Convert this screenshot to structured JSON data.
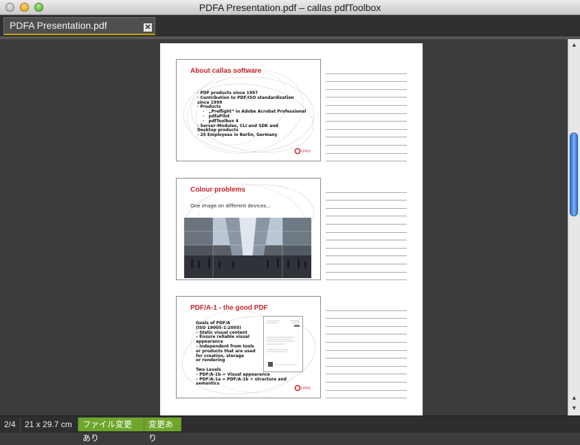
{
  "window": {
    "title": "PDFA Presentation.pdf – callas pdfToolbox"
  },
  "tab": {
    "label": "PDFA Presentation.pdf",
    "close_glyph": "✕"
  },
  "slides": [
    {
      "title": "About callas software",
      "bullets": [
        "· PDF products since 1997",
        "· Contribution to PDF/ISO standardization",
        "  since 1999",
        "· Products",
        "„Preflight“ in Adobe Acrobat Professional",
        "pdfaPilot",
        "pdfToolbox 4",
        "· Server-Modules, CLI and SDK and",
        "  Desktop products",
        "· 25 Employees in Berlin, Germany"
      ],
      "logo": "callas"
    },
    {
      "title": "Colour problems",
      "subtitle": "One image on different devices...",
      "logo": ""
    },
    {
      "title": "PDF/A-1 - the good PDF",
      "bullets": [
        "Goals of PDF/A",
        "(ISO 19005-1:2005)",
        "–   Static visual content",
        "–   Ensure reliable visual",
        "     appearance",
        "–   Independent from tools",
        "     or products that are used",
        "     for creation, storage",
        "     or rendering",
        "",
        "Two Levels",
        "–   PDF/A-1b = Visual appearance",
        "–   PDF/A-1a = PDF/A-1b + structure and",
        "     semantics"
      ],
      "logo": "callas"
    }
  ],
  "status": {
    "page": "2/4",
    "size": "21 x 29.7 cm",
    "file_changed": "ファイル変更あり",
    "changed": "変更あり"
  },
  "colors": {
    "accent_red": "#c8232c",
    "status_green": "#6ea52b",
    "scroll_blue": "#2d6fd0"
  }
}
